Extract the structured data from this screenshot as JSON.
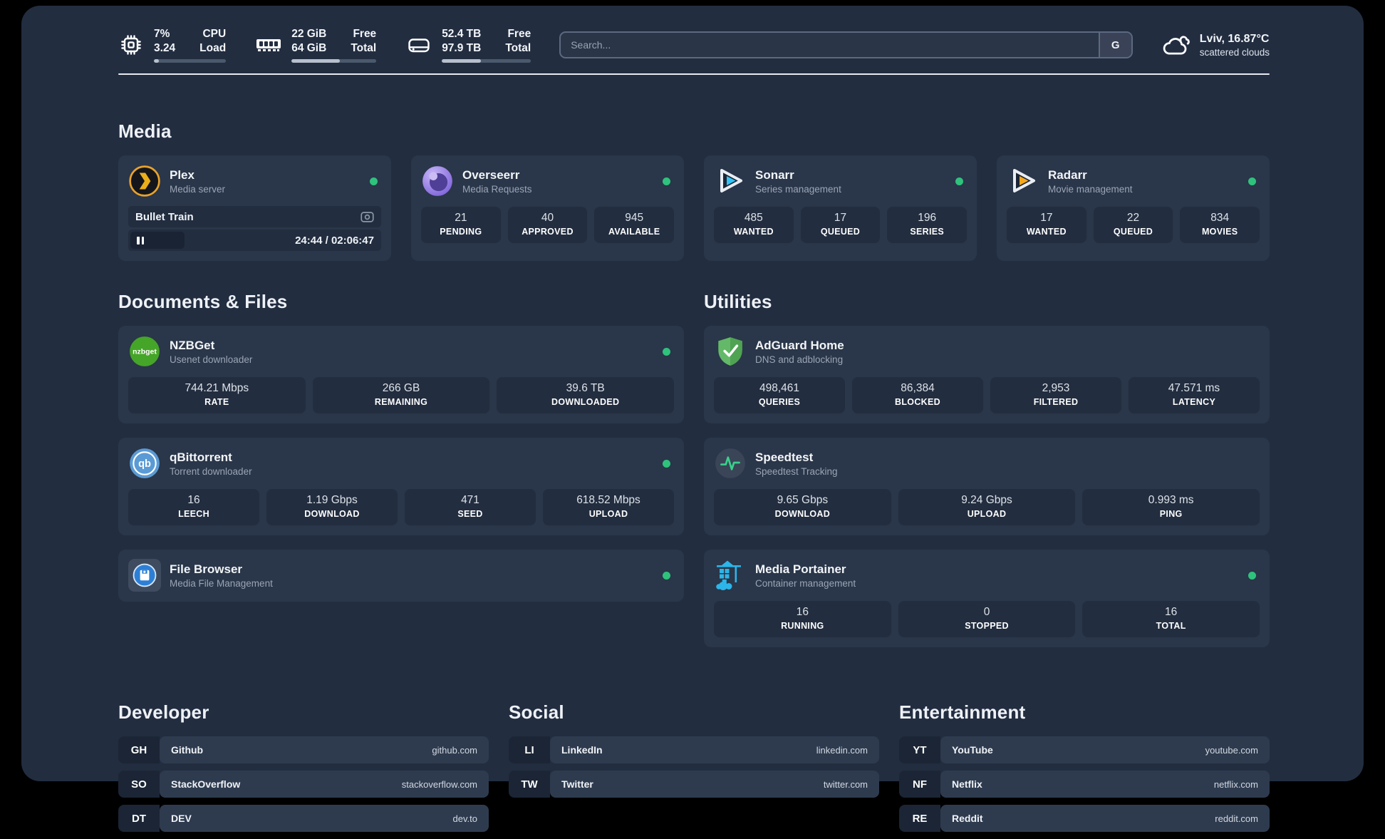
{
  "colors": {
    "background": "#222d40",
    "card": "#2a3649",
    "stat_box": "#222d3f",
    "status_online": "#2fc27d",
    "accent_plex": "#ebaf1a",
    "accent_sonarr": "#32c4f4",
    "accent_radarr": "#f6a81c"
  },
  "topbar": {
    "cpu": {
      "pct": "7%",
      "load": "3.24",
      "label1": "CPU",
      "label2": "Load",
      "progress_pct": 7
    },
    "ram": {
      "free": "22 GiB",
      "total": "64 GiB",
      "label1": "Free",
      "label2": "Total",
      "progress_pct": 57
    },
    "disk": {
      "free": "52.4 TB",
      "total": "97.9 TB",
      "label1": "Free",
      "label2": "Total",
      "progress_pct": 44
    },
    "search": {
      "placeholder": "Search...",
      "button_label": "G"
    },
    "weather": {
      "line1": "Lviv, 16.87°C",
      "line2": "scattered clouds"
    }
  },
  "sections": {
    "media": {
      "title": "Media",
      "cards": [
        {
          "title": "Plex",
          "subtitle": "Media server",
          "status": "online",
          "now_playing": {
            "name": "Bullet Train",
            "time": "24:44 / 02:06:47"
          }
        },
        {
          "title": "Overseerr",
          "subtitle": "Media Requests",
          "status": "online",
          "stats": [
            {
              "value": "21",
              "label": "PENDING"
            },
            {
              "value": "40",
              "label": "APPROVED"
            },
            {
              "value": "945",
              "label": "AVAILABLE"
            }
          ]
        },
        {
          "title": "Sonarr",
          "subtitle": "Series management",
          "status": "online",
          "stats": [
            {
              "value": "485",
              "label": "WANTED"
            },
            {
              "value": "17",
              "label": "QUEUED"
            },
            {
              "value": "196",
              "label": "SERIES"
            }
          ]
        },
        {
          "title": "Radarr",
          "subtitle": "Movie management",
          "status": "online",
          "stats": [
            {
              "value": "17",
              "label": "WANTED"
            },
            {
              "value": "22",
              "label": "QUEUED"
            },
            {
              "value": "834",
              "label": "MOVIES"
            }
          ]
        }
      ]
    },
    "documents": {
      "title": "Documents & Files",
      "cards": [
        {
          "title": "NZBGet",
          "subtitle": "Usenet downloader",
          "status": "online",
          "icon_text": "nzbget",
          "stats": [
            {
              "value": "744.21 Mbps",
              "label": "RATE"
            },
            {
              "value": "266 GB",
              "label": "REMAINING"
            },
            {
              "value": "39.6 TB",
              "label": "DOWNLOADED"
            }
          ]
        },
        {
          "title": "qBittorrent",
          "subtitle": "Torrent downloader",
          "status": "online",
          "icon_text": "qb",
          "stats": [
            {
              "value": "16",
              "label": "LEECH"
            },
            {
              "value": "1.19 Gbps",
              "label": "DOWNLOAD"
            },
            {
              "value": "471",
              "label": "SEED"
            },
            {
              "value": "618.52 Mbps",
              "label": "UPLOAD"
            }
          ]
        },
        {
          "title": "File Browser",
          "subtitle": "Media File Management",
          "status": "online"
        }
      ]
    },
    "utilities": {
      "title": "Utilities",
      "cards": [
        {
          "title": "AdGuard Home",
          "subtitle": "DNS and adblocking",
          "stats": [
            {
              "value": "498,461",
              "label": "QUERIES"
            },
            {
              "value": "86,384",
              "label": "BLOCKED"
            },
            {
              "value": "2,953",
              "label": "FILTERED"
            },
            {
              "value": "47.571 ms",
              "label": "LATENCY"
            }
          ]
        },
        {
          "title": "Speedtest",
          "subtitle": "Speedtest Tracking",
          "stats": [
            {
              "value": "9.65 Gbps",
              "label": "DOWNLOAD"
            },
            {
              "value": "9.24 Gbps",
              "label": "UPLOAD"
            },
            {
              "value": "0.993 ms",
              "label": "PING"
            }
          ]
        },
        {
          "title": "Media Portainer",
          "subtitle": "Container management",
          "status": "online",
          "stats": [
            {
              "value": "16",
              "label": "RUNNING"
            },
            {
              "value": "0",
              "label": "STOPPED"
            },
            {
              "value": "16",
              "label": "TOTAL"
            }
          ]
        }
      ]
    },
    "bookmarks": [
      {
        "title": "Developer",
        "links": [
          {
            "abbr": "GH",
            "name": "Github",
            "url": "github.com"
          },
          {
            "abbr": "SO",
            "name": "StackOverflow",
            "url": "stackoverflow.com"
          },
          {
            "abbr": "DT",
            "name": "DEV",
            "url": "dev.to"
          }
        ]
      },
      {
        "title": "Social",
        "links": [
          {
            "abbr": "LI",
            "name": "LinkedIn",
            "url": "linkedin.com"
          },
          {
            "abbr": "TW",
            "name": "Twitter",
            "url": "twitter.com"
          }
        ]
      },
      {
        "title": "Entertainment",
        "links": [
          {
            "abbr": "YT",
            "name": "YouTube",
            "url": "youtube.com"
          },
          {
            "abbr": "NF",
            "name": "Netflix",
            "url": "netflix.com"
          },
          {
            "abbr": "RE",
            "name": "Reddit",
            "url": "reddit.com"
          }
        ]
      }
    ]
  }
}
